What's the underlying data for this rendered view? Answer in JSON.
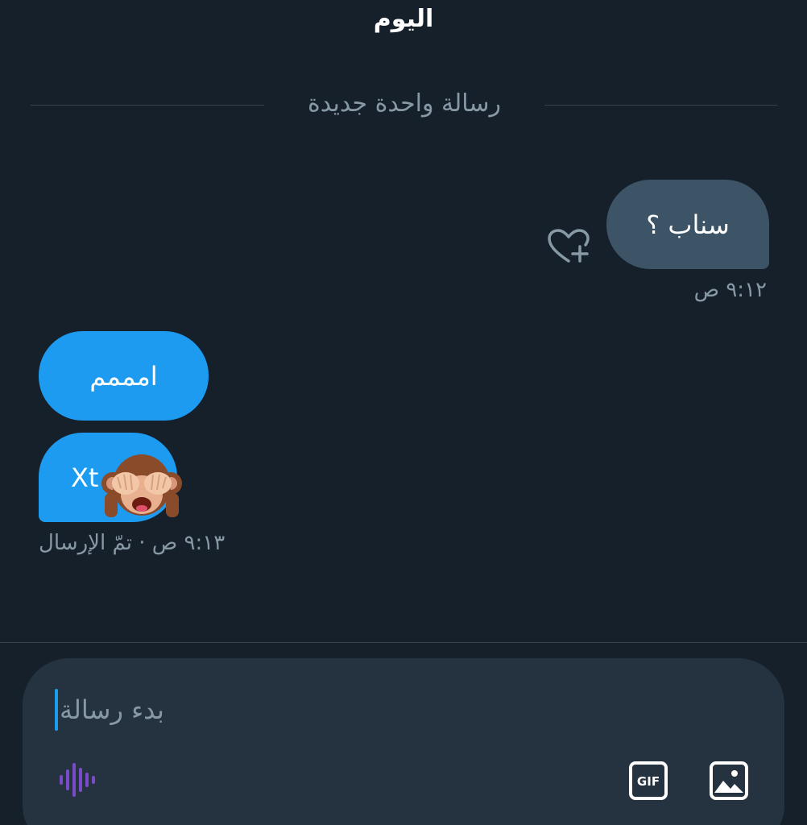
{
  "header": {
    "day_label": "اليوم"
  },
  "divider": {
    "label": "رسالة واحدة جديدة"
  },
  "messages": [
    {
      "text": "سناب ؟",
      "direction": "sent",
      "timestamp": "٩:١٢ ص"
    },
    {
      "text": "امممم",
      "direction": "received"
    },
    {
      "text": "Xt",
      "emoji": "see-no-evil-monkey",
      "direction": "received",
      "timestamp": "٩:١٣ ص · تمّ الإرسال"
    }
  ],
  "composer": {
    "placeholder": "بدء رسالة"
  },
  "icons": {
    "react": "heart-plus-icon",
    "voice": "voice-message-icon",
    "gif": "gif-icon",
    "image": "image-icon"
  },
  "colors": {
    "background": "#15202b",
    "sent_bubble": "#3d5466",
    "received_bubble": "#1d9bf0",
    "composer": "#253341",
    "muted_text": "#8899a6",
    "accent_voice": "#794bc4"
  }
}
